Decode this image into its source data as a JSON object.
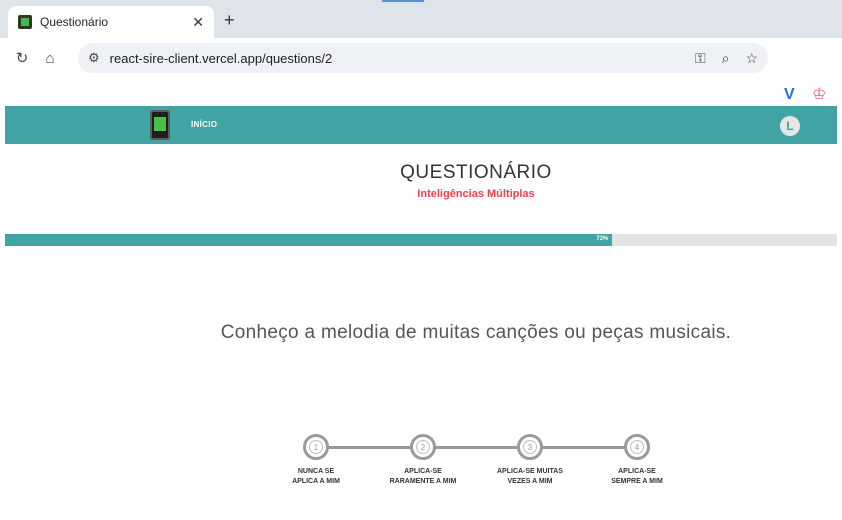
{
  "browser": {
    "tab_title": "Questionário",
    "url": "react-sire-client.vercel.app/questions/2"
  },
  "header": {
    "nav_home": "INÍCIO",
    "avatar_letter": "L"
  },
  "page": {
    "title": "QUESTIONÁRIO",
    "subtitle": "Inteligências Múltiplas"
  },
  "progress": {
    "percent": 73,
    "label": "73%"
  },
  "question": {
    "text": "Conheço a melodia de muitas canções ou peças musicais."
  },
  "options": [
    {
      "number": "1",
      "line1": "NUNCA SE",
      "line2": "APLICA A MIM"
    },
    {
      "number": "2",
      "line1": "APLICA-SE",
      "line2": "RARAMENTE A MIM"
    },
    {
      "number": "3",
      "line1": "APLICA-SE MUITAS",
      "line2": "VEZES A MIM"
    },
    {
      "number": "4",
      "line1": "APLICA-SE",
      "line2": "SEMPRE A MIM"
    }
  ],
  "colors": {
    "primary": "#41a3a3",
    "accent": "#e8444b"
  }
}
